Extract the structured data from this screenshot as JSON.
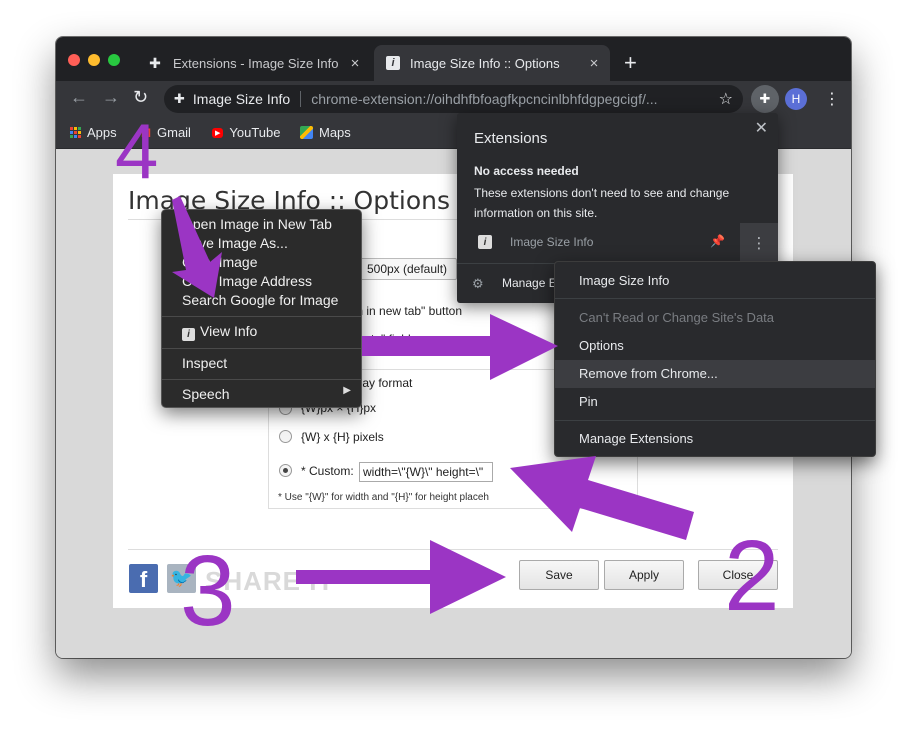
{
  "browser": {
    "tabs": [
      {
        "label": "Extensions - Image Size Info",
        "active": false
      },
      {
        "label": "Image Size Info :: Options",
        "active": true
      }
    ],
    "new_tab": "+",
    "tab_close": "×",
    "omnibox": {
      "site_name": "Image Size Info",
      "url": "chrome-extension://oihdhfbfoagfkpcncinlbhfdgpegcigf/..."
    },
    "avatar_letter": "H",
    "bookmarks": [
      {
        "label": "Apps",
        "icon": "apps-grid-icon"
      },
      {
        "label": "Gmail",
        "icon": "gmail-icon"
      },
      {
        "label": "YouTube",
        "icon": "youtube-icon"
      },
      {
        "label": "Maps",
        "icon": "maps-icon"
      }
    ]
  },
  "page": {
    "title": "Image Size Info :: Options",
    "size_select_value": "500px (default)",
    "option_newtab_text": "pen in new tab\" button",
    "option_field_text": "te\" field",
    "display_format_legend": "play format",
    "formats": [
      {
        "label": "{W}px × {H}px",
        "checked": false
      },
      {
        "label": "{W} x {H} pixels",
        "checked": false
      },
      {
        "label": "* Custom:",
        "checked": true
      }
    ],
    "custom_value": "width=\\\"{W}\\\" height=\\\"",
    "note": "* Use \"{W}\" for width and \"{H}\" for height placeh",
    "share_text": "SHARE IT",
    "buttons": {
      "save": "Save",
      "apply": "Apply",
      "close": "Close"
    }
  },
  "context_menu": {
    "items": [
      "Open Image in New Tab",
      "Save Image As...",
      "Copy Image",
      "Copy Image Address",
      "Search Google for Image"
    ],
    "view_info": "View Info",
    "inspect": "Inspect",
    "speech": "Speech"
  },
  "extensions_popup": {
    "title": "Extensions",
    "subtitle": "No access needed",
    "description": "These extensions don't need to see and change information on this site.",
    "extension_name": "Image Size Info",
    "manage": "Manage E"
  },
  "extension_menu": {
    "items": [
      {
        "label": "Image Size Info",
        "disabled": false
      },
      {
        "label": "Can't Read or Change Site's Data",
        "disabled": true
      },
      {
        "label": "Options",
        "disabled": false
      },
      {
        "label": "Remove from Chrome...",
        "disabled": false
      },
      {
        "label": "Pin",
        "disabled": false
      },
      {
        "label": "Manage Extensions",
        "disabled": false
      }
    ]
  },
  "annotations": {
    "step_2": "2",
    "step_3": "3",
    "step_4": "4",
    "color": "#9b35c4"
  }
}
